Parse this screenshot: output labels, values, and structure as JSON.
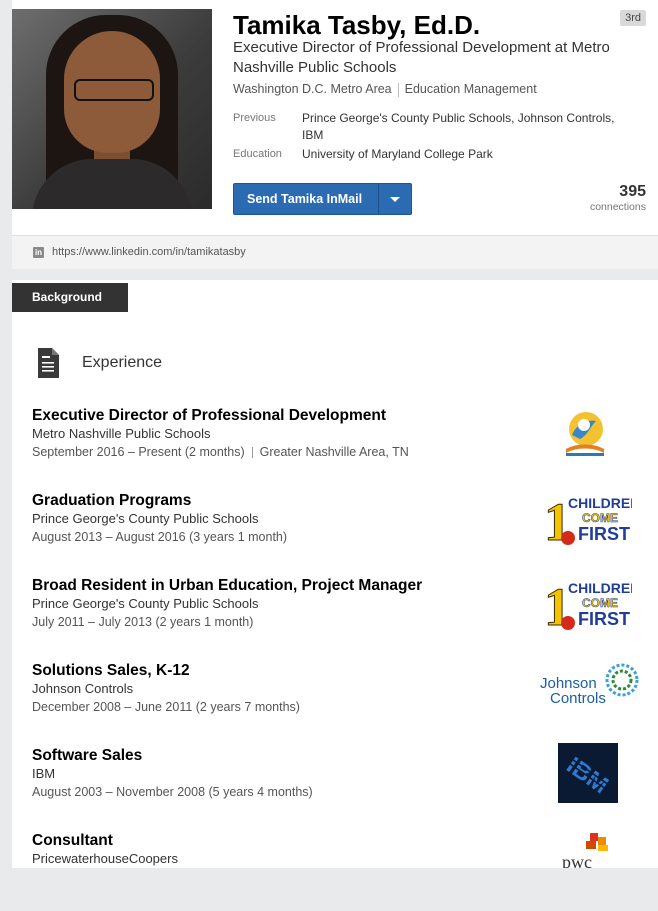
{
  "profile": {
    "name": "Tamika Tasby, Ed.D.",
    "degree": "3rd",
    "headline": "Executive Director of Professional Development at Metro Nashville Public Schools",
    "location": "Washington D.C. Metro Area",
    "industry": "Education Management",
    "previous_label": "Previous",
    "previous_value": "Prince George's County Public Schools, Johnson Controls, IBM",
    "education_label": "Education",
    "education_value": "University of Maryland College Park",
    "inmail_label": "Send Tamika InMail",
    "connections_count": "395",
    "connections_label": "connections",
    "url": "https://www.linkedin.com/in/tamikatasby",
    "url_icon_text": "in"
  },
  "background": {
    "tab_label": "Background",
    "experience_heading": "Experience"
  },
  "experience": [
    {
      "title": "Executive Director of Professional Development",
      "company": "Metro Nashville Public Schools",
      "dates": "September 2016 – Present (2 months)",
      "location": "Greater Nashville Area, TN",
      "logo": "mnps-logo"
    },
    {
      "title": "Graduation Programs",
      "company": "Prince George's County Public Schools",
      "dates": "August 2013 – August 2016 (3 years 1 month)",
      "logo": "children-come-first-logo"
    },
    {
      "title": "Broad Resident in Urban Education, Project Manager",
      "company": "Prince George's County Public Schools",
      "dates": "July 2011 – July 2013 (2 years 1 month)",
      "logo": "children-come-first-logo"
    },
    {
      "title": "Solutions Sales, K-12",
      "company": "Johnson Controls",
      "dates": "December 2008 – June 2011 (2 years 7 months)",
      "logo": "johnson-controls-logo",
      "logo_text_1": "Johnson",
      "logo_text_2": "Controls"
    },
    {
      "title": "Software Sales",
      "company": "IBM",
      "dates": "August 2003 – November 2008 (5 years 4 months)",
      "logo": "ibm-logo",
      "logo_text": "IBM"
    },
    {
      "title": "Consultant",
      "company": "PricewaterhouseCoopers",
      "dates": "",
      "logo": "pwc-logo",
      "logo_text": "pwc"
    }
  ],
  "logo_text": {
    "ccf_line1": "CHILDREN",
    "ccf_line2": "COME",
    "ccf_line3": "FIRST",
    "ccf_digit": "1"
  },
  "colors": {
    "button_blue": "#2a6bb2",
    "tab_dark": "#333333"
  }
}
